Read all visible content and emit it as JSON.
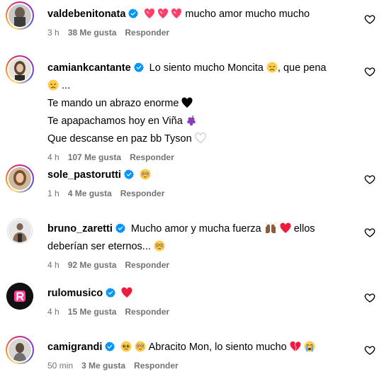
{
  "comments": [
    {
      "username": "valdebenitonata",
      "lines": [
        "mucho amor mucho mucho"
      ],
      "time": "3 h",
      "likes": "38 Me gusta",
      "reply": "Responder"
    },
    {
      "username": "camiankcantante",
      "lines": [
        "Lo siento mucho Moncita",
        ", que pena",
        "...",
        "Te mando un abrazo enorme",
        "Te apapachamos hoy en Viña",
        "Que descanse en paz bb Tyson"
      ],
      "time": "4 h",
      "likes": "107 Me gusta",
      "reply": "Responder"
    },
    {
      "username": "sole_pastorutti",
      "lines": [],
      "time": "1 h",
      "likes": "4 Me gusta",
      "reply": "Responder"
    },
    {
      "username": "bruno_zaretti",
      "lines": [
        "Mucho amor y mucha fuerza",
        "ellos",
        "deberían ser eternos..."
      ],
      "time": "4 h",
      "likes": "92 Me gusta",
      "reply": "Responder"
    },
    {
      "username": "rulomusico",
      "lines": [],
      "time": "4 h",
      "likes": "15 Me gusta",
      "reply": "Responder"
    },
    {
      "username": "camigrandi",
      "lines": [
        "Abracito Mon, lo siento mucho"
      ],
      "time": "50 min",
      "likes": "3 Me gusta",
      "reply": "Responder"
    }
  ],
  "colors": {
    "verified": "#0095f6",
    "meta_text": "#737373",
    "heart_red": "#ed1c3e",
    "story_ring": [
      "#feda75",
      "#fa7e1e",
      "#d62976",
      "#962fbf",
      "#4f5bd5"
    ]
  },
  "icons": {
    "like_button": "heart-outline-icon",
    "verified_badge": "verified-badge-icon"
  }
}
